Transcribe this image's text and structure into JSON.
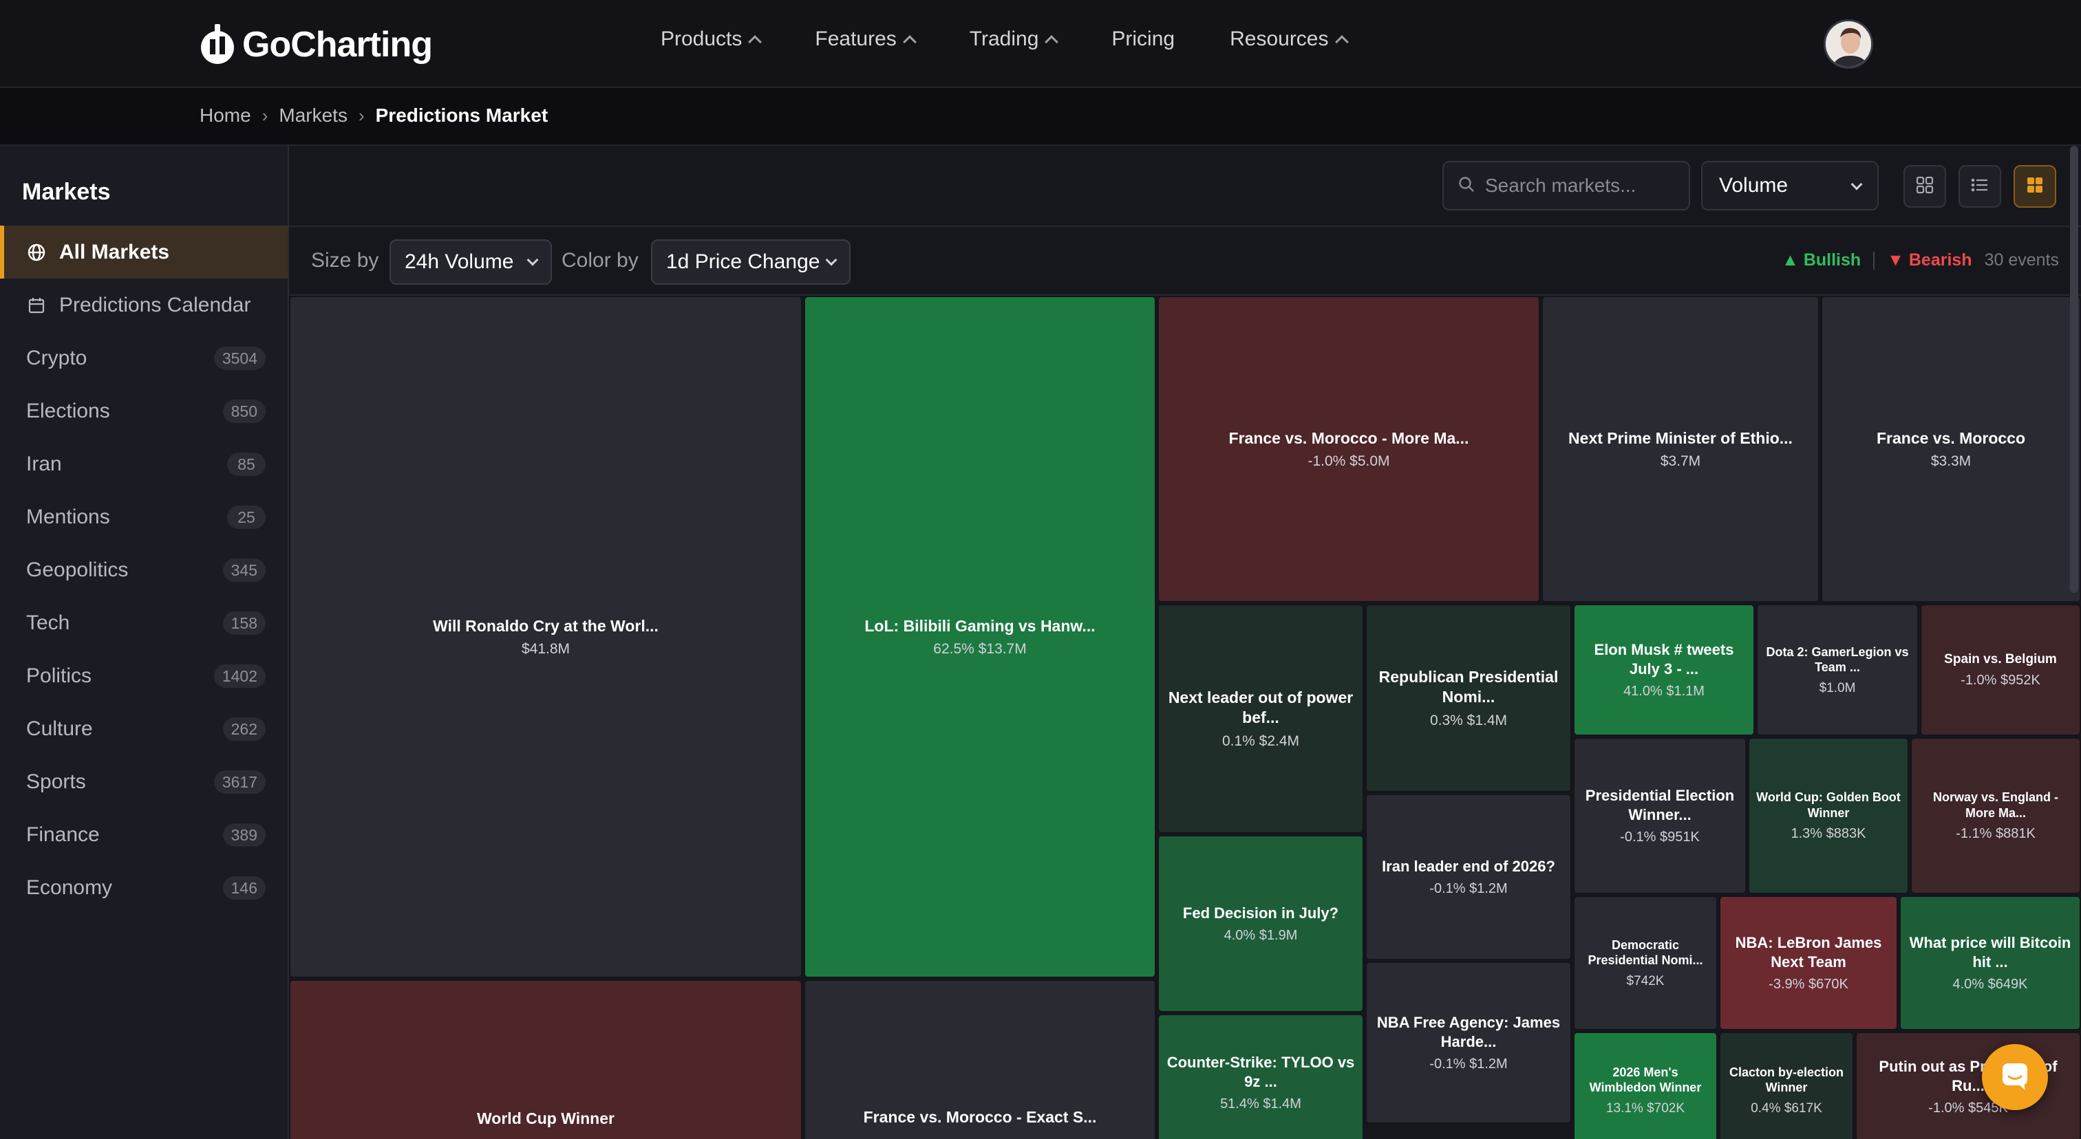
{
  "app": {
    "logo_text": "GoCharting"
  },
  "nav": {
    "items": [
      "Products",
      "Features",
      "Trading",
      "Pricing",
      "Resources"
    ]
  },
  "breadcrumb": {
    "home": "Home",
    "markets": "Markets",
    "current": "Predictions Market",
    "sep": "›"
  },
  "sidebar": {
    "title": "Markets",
    "items": [
      {
        "label": "All Markets",
        "count": ""
      },
      {
        "label": "Predictions Calendar",
        "count": ""
      },
      {
        "label": "Crypto",
        "count": "3504"
      },
      {
        "label": "Elections",
        "count": "850"
      },
      {
        "label": "Iran",
        "count": "85"
      },
      {
        "label": "Mentions",
        "count": "25"
      },
      {
        "label": "Geopolitics",
        "count": "345"
      },
      {
        "label": "Tech",
        "count": "158"
      },
      {
        "label": "Politics",
        "count": "1402"
      },
      {
        "label": "Culture",
        "count": "262"
      },
      {
        "label": "Sports",
        "count": "3617"
      },
      {
        "label": "Finance",
        "count": "389"
      },
      {
        "label": "Economy",
        "count": "146"
      }
    ]
  },
  "toolbar": {
    "search_placeholder": "Search markets...",
    "sort_value": "Volume"
  },
  "filters": {
    "size_label": "Size by",
    "size_value": "24h Volume",
    "color_label": "Color by",
    "color_value": "1d Price Change",
    "bullish": "▲ Bullish",
    "bearish": "▼ Bearish",
    "events": "30 events"
  },
  "treemap": {
    "tiles": [
      {
        "title": "Will Ronaldo Cry at the Worl...",
        "sub": "$41.8M"
      },
      {
        "title": "LoL: Bilibili Gaming vs Hanw...",
        "sub": "62.5% $13.7M"
      },
      {
        "title": "France vs. Morocco - More Ma...",
        "sub": "-1.0% $5.0M"
      },
      {
        "title": "Next Prime Minister of Ethio...",
        "sub": "$3.7M"
      },
      {
        "title": "France vs. Morocco",
        "sub": "$3.3M"
      },
      {
        "title": "Next leader out of power bef...",
        "sub": "0.1% $2.4M"
      },
      {
        "title": "Republican Presidential Nomi...",
        "sub": "0.3% $1.4M"
      },
      {
        "title": "Elon Musk # tweets July 3 - ...",
        "sub": "41.0% $1.1M"
      },
      {
        "title": "Dota 2: GamerLegion vs Team ...",
        "sub": "$1.0M"
      },
      {
        "title": "Spain vs. Belgium",
        "sub": "-1.0% $952K"
      },
      {
        "title": "Presidential Election Winner...",
        "sub": "-0.1% $951K"
      },
      {
        "title": "World Cup: Golden Boot Winner",
        "sub": "1.3% $883K"
      },
      {
        "title": "Norway vs. England - More Ma...",
        "sub": "-1.1% $881K"
      },
      {
        "title": "Iran leader end of 2026?",
        "sub": "-0.1% $1.2M"
      },
      {
        "title": "Fed Decision in July?",
        "sub": "4.0% $1.9M"
      },
      {
        "title": "Democratic Presidential Nomi...",
        "sub": "$742K"
      },
      {
        "title": "NBA: LeBron James Next Team",
        "sub": "-3.9% $670K"
      },
      {
        "title": "What price will Bitcoin hit ...",
        "sub": "4.0% $649K"
      },
      {
        "title": "NBA Free Agency: James Harde...",
        "sub": "-0.1% $1.2M"
      },
      {
        "title": "Counter-Strike: TYLOO vs 9z ...",
        "sub": "51.4% $1.4M"
      },
      {
        "title": "2026 Men's Wimbledon Winner",
        "sub": "13.1% $702K"
      },
      {
        "title": "Clacton by-election Winner",
        "sub": "0.4% $617K"
      },
      {
        "title": "Putin out as President of Ru...",
        "sub": "-1.0% $545K"
      },
      {
        "title": "World Cup Winner",
        "sub": ""
      },
      {
        "title": "France vs. Morocco - Exact S...",
        "sub": ""
      }
    ]
  },
  "colors": {
    "accent": "#e79b1f",
    "bullish": "#2fbf5d",
    "bearish": "#ef4a4a"
  }
}
